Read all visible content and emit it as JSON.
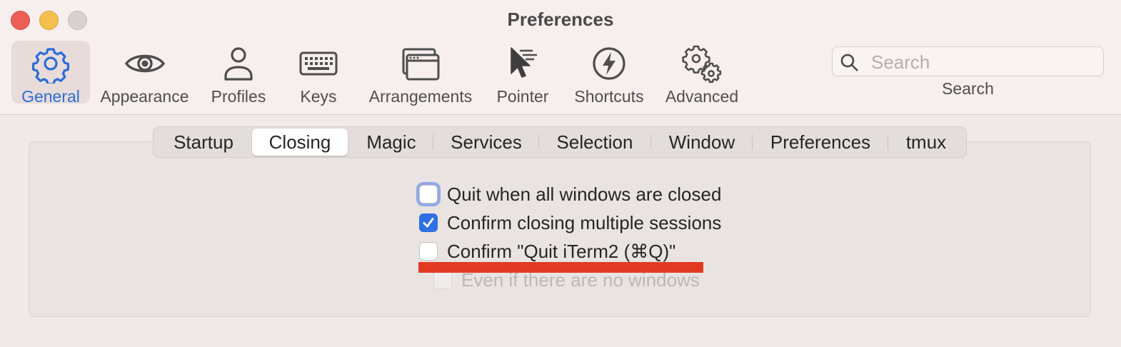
{
  "window": {
    "title": "Preferences"
  },
  "toolbar": {
    "items": [
      {
        "label": "General",
        "icon": "gear-icon"
      },
      {
        "label": "Appearance",
        "icon": "eye-icon"
      },
      {
        "label": "Profiles",
        "icon": "person-icon"
      },
      {
        "label": "Keys",
        "icon": "keyboard-icon"
      },
      {
        "label": "Arrangements",
        "icon": "windows-icon"
      },
      {
        "label": "Pointer",
        "icon": "pointer-icon"
      },
      {
        "label": "Shortcuts",
        "icon": "lightning-icon"
      },
      {
        "label": "Advanced",
        "icon": "gears-icon"
      }
    ],
    "selected": "General"
  },
  "search": {
    "placeholder": "Search",
    "caption": "Search"
  },
  "tabs": {
    "items": [
      "Startup",
      "Closing",
      "Magic",
      "Services",
      "Selection",
      "Window",
      "Preferences",
      "tmux"
    ],
    "selected": "Closing"
  },
  "options": [
    {
      "label": "Quit when all windows are closed",
      "checked": false,
      "focused": true,
      "enabled": true
    },
    {
      "label": "Confirm closing multiple sessions",
      "checked": true,
      "enabled": true
    },
    {
      "label": "Confirm \"Quit iTerm2 (⌘Q)\"",
      "checked": false,
      "enabled": true
    },
    {
      "label": "Even if there are no windows",
      "checked": false,
      "enabled": false
    }
  ],
  "colors": {
    "accent": "#2f6fe4",
    "annotation_underline": "#e23a22"
  }
}
